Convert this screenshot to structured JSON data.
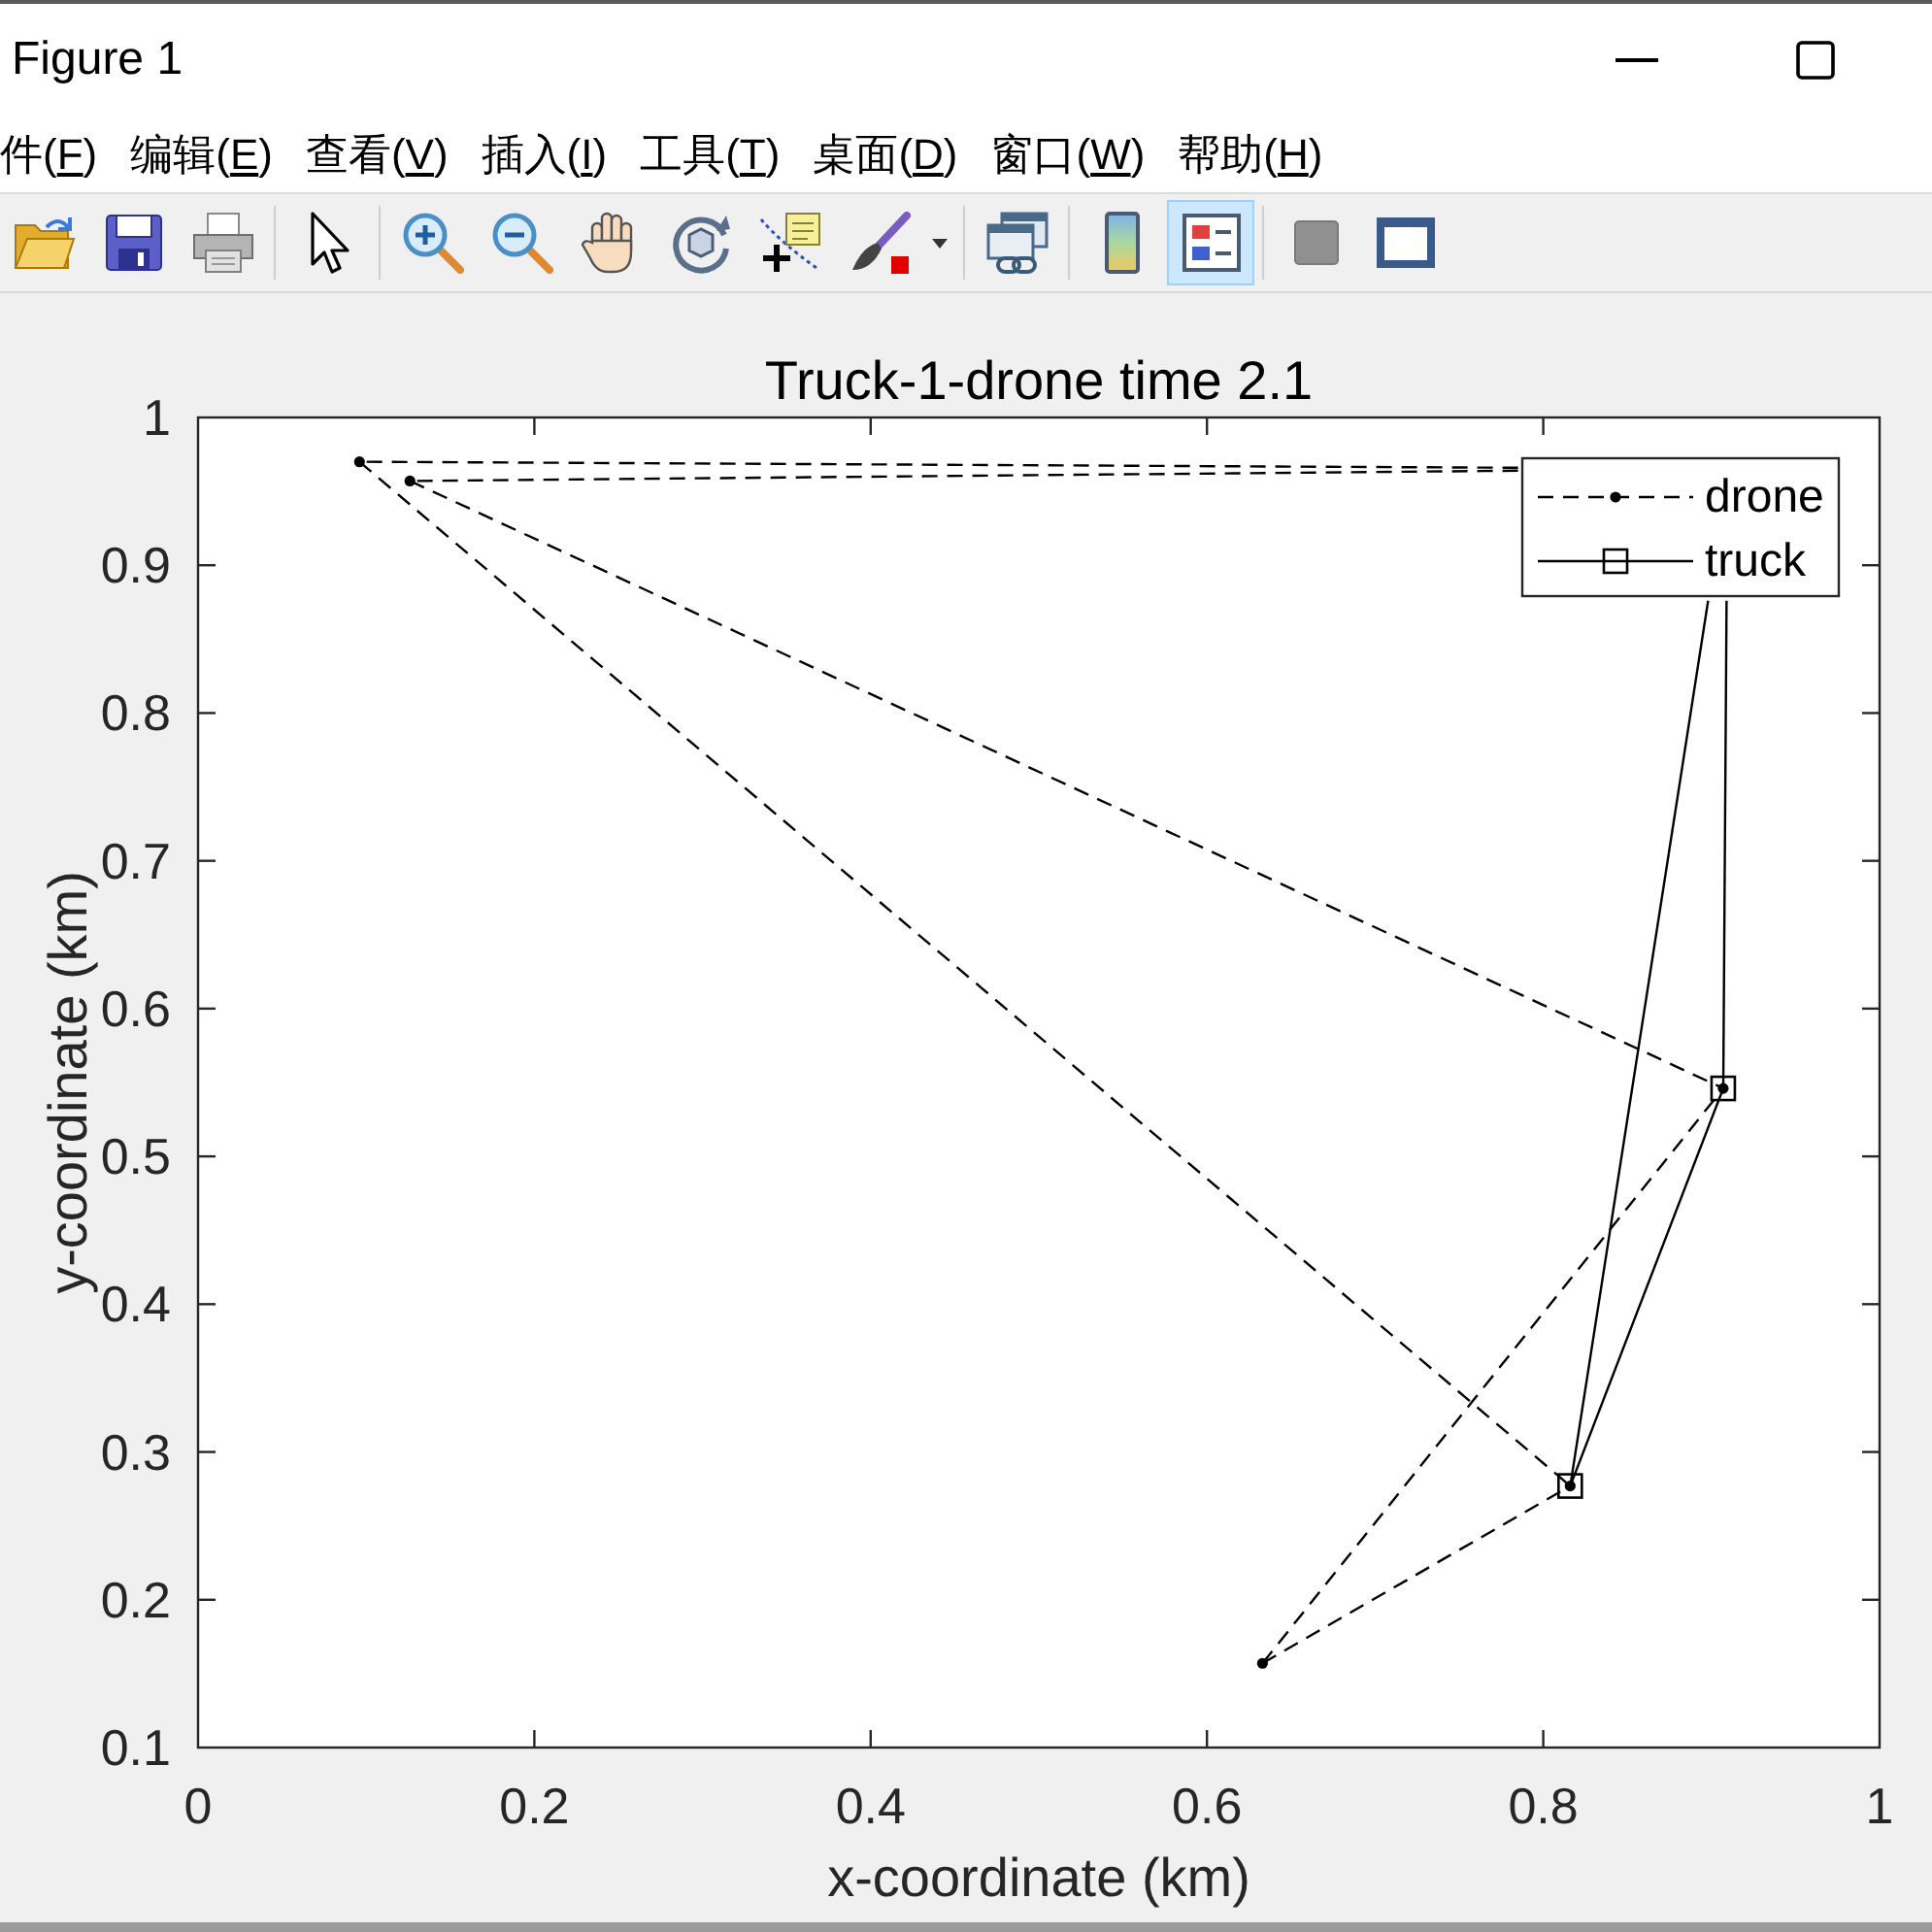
{
  "window": {
    "title": "Figure 1"
  },
  "menu": [
    {
      "prefix": "件(",
      "key": "F",
      "suffix": ")"
    },
    {
      "prefix": "编辑(",
      "key": "E",
      "suffix": ")"
    },
    {
      "prefix": "查看(",
      "key": "V",
      "suffix": ")"
    },
    {
      "prefix": "插入(",
      "key": "I",
      "suffix": ")"
    },
    {
      "prefix": "工具(",
      "key": "T",
      "suffix": ")"
    },
    {
      "prefix": "桌面(",
      "key": "D",
      "suffix": ")"
    },
    {
      "prefix": "窗口(",
      "key": "W",
      "suffix": ")"
    },
    {
      "prefix": "帮助(",
      "key": "H",
      "suffix": ")"
    }
  ],
  "toolbar": {
    "groups": [
      {
        "items": [
          {
            "kind": "open"
          },
          {
            "kind": "save"
          },
          {
            "kind": "print"
          }
        ]
      },
      {
        "items": [
          {
            "kind": "pointer",
            "pressed": false
          }
        ]
      },
      {
        "items": [
          {
            "kind": "zoom_in",
            "pressed": false
          },
          {
            "kind": "zoom_out",
            "pressed": false
          },
          {
            "kind": "pan",
            "pressed": false
          },
          {
            "kind": "rotate",
            "pressed": false
          },
          {
            "kind": "data_cursor",
            "pressed": false
          },
          {
            "kind": "brush",
            "pressed": false
          },
          {
            "kind": "menu_arrow"
          }
        ]
      },
      {
        "items": [
          {
            "kind": "link",
            "pressed": false
          }
        ]
      },
      {
        "items": [
          {
            "kind": "colorbar",
            "pressed": false
          },
          {
            "kind": "legend",
            "pressed": true
          }
        ]
      },
      {
        "items": [
          {
            "kind": "hide_tools"
          },
          {
            "kind": "show_tools"
          }
        ]
      }
    ]
  },
  "figure": {
    "chart_data": {
      "type": "line",
      "title": "Truck-1-drone time 2.1",
      "xlabel": "x-coordinate (km)",
      "ylabel": "y-coordinate (km)",
      "xlim": [
        0,
        1
      ],
      "ylim": [
        0.1,
        1
      ],
      "xticks": [
        0,
        0.2,
        0.4,
        0.6,
        0.8,
        1
      ],
      "yticks": [
        0.1,
        0.2,
        0.3,
        0.4,
        0.5,
        0.6,
        0.7,
        0.8,
        0.9,
        1
      ],
      "legend": "upper right",
      "series": [
        {
          "name": "drone",
          "color": "#000000",
          "line_style": "dashed",
          "marker": "circle",
          "x": [
            0.785,
            0.096,
            null,
            0.096,
            0.816,
            null,
            0.633,
            0.816,
            null,
            0.633,
            0.907,
            null,
            0.126,
            0.907,
            null,
            0.785,
            0.126
          ],
          "values": [
            0.966,
            0.97,
            null,
            0.97,
            0.277,
            null,
            0.157,
            0.277,
            null,
            0.157,
            0.546,
            null,
            0.957,
            0.546,
            null,
            0.964,
            0.957
          ]
        },
        {
          "name": "truck",
          "color": "#000000",
          "line_style": "solid",
          "x": [
            0.816,
            0.907,
            null,
            0.907,
            0.909,
            null,
            0.816,
            0.898
          ],
          "values": [
            0.277,
            0.546,
            null,
            0.546,
            0.876,
            null,
            0.277,
            0.876
          ]
        }
      ]
    }
  }
}
